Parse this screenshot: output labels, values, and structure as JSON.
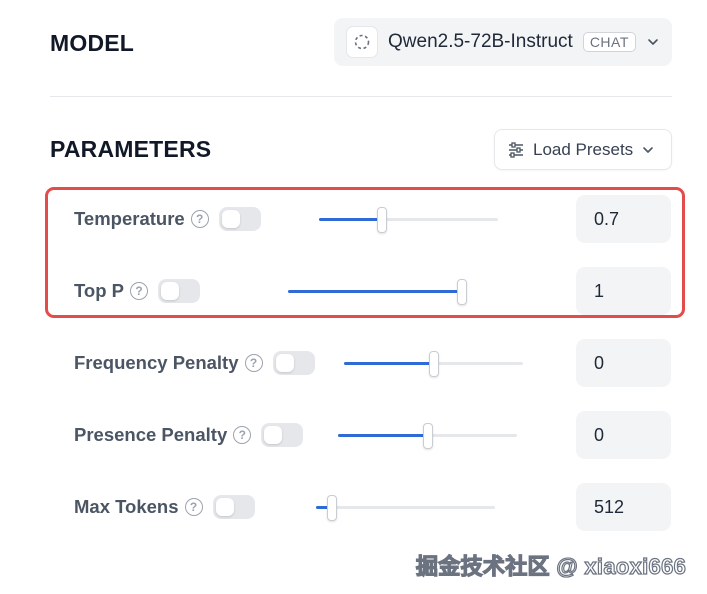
{
  "model_section": {
    "title": "MODEL",
    "selected_model": "Qwen2.5-72B-Instruct",
    "badge": "CHAT",
    "icon": "model-spinner-icon"
  },
  "parameters_section": {
    "title": "PARAMETERS",
    "presets_label": "Load Presets",
    "presets_icon": "sliders-icon",
    "highlight_color": "#e44b4b",
    "accent_color": "#2f6ad8",
    "params": [
      {
        "label": "Temperature",
        "value": "0.7",
        "slider_fraction": 0.35,
        "enabled": false
      },
      {
        "label": "Top P",
        "value": "1",
        "slider_fraction": 1.0,
        "enabled": false
      },
      {
        "label": "Frequency Penalty",
        "value": "0",
        "slider_fraction": 0.5,
        "enabled": false
      },
      {
        "label": "Presence Penalty",
        "value": "0",
        "slider_fraction": 0.5,
        "enabled": false
      },
      {
        "label": "Max Tokens",
        "value": "512",
        "slider_fraction": 0.09,
        "enabled": false
      }
    ]
  },
  "watermark": "掘金技术社区 @ xiaoxi666"
}
